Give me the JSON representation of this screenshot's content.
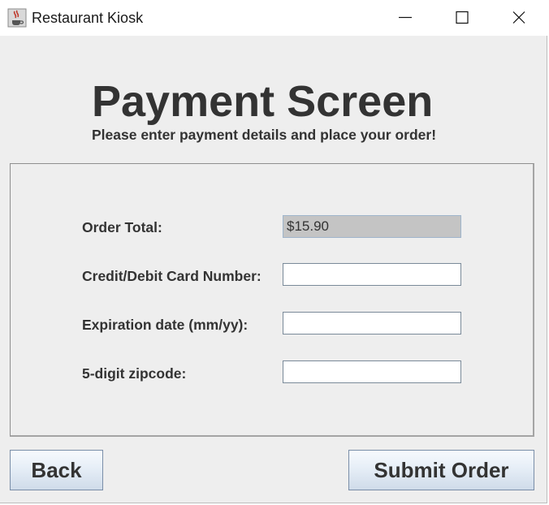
{
  "window": {
    "title": "Restaurant Kiosk",
    "icon": "java-coffee-cup-icon",
    "controls": [
      "minimize-icon",
      "maximize-icon",
      "close-icon"
    ]
  },
  "header": {
    "title": "Payment Screen",
    "subtitle": "Please enter payment details and place your order!"
  },
  "form": {
    "order_total_label": "Order Total:",
    "order_total_value": "$15.90",
    "card_number_label": "Credit/Debit Card Number:",
    "card_number_value": "",
    "expiration_label": "Expiration date (mm/yy):",
    "expiration_value": "",
    "zipcode_label": "5-digit zipcode:",
    "zipcode_value": ""
  },
  "buttons": {
    "back_label": "Back",
    "submit_label": "Submit Order"
  },
  "colors": {
    "background": "#eeeeee",
    "text": "#333333",
    "readonly_field": "#c4c4c4"
  }
}
